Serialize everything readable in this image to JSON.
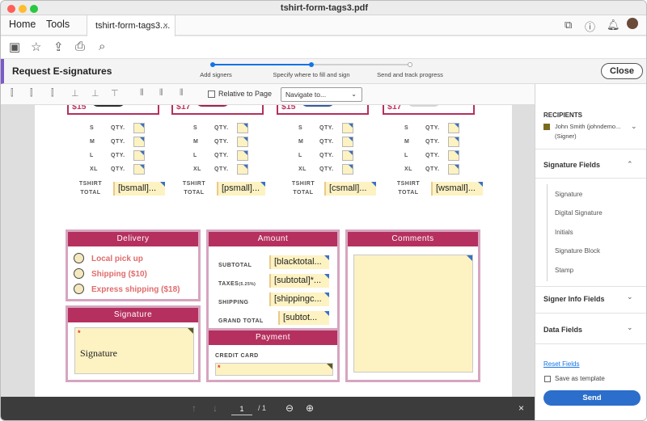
{
  "window": {
    "title": "tshirt-form-tags3.pdf"
  },
  "nav": {
    "home": "Home",
    "tools": "Tools",
    "tab_label": "tshirt-form-tags3....",
    "tab_close": "×"
  },
  "esign": {
    "title": "Request E-signatures",
    "steps": [
      "Add signers",
      "Specify where to fill and sign",
      "Send and track progress"
    ],
    "close": "Close"
  },
  "align_bar": {
    "relative_label": "Relative to Page",
    "navigate_placeholder": "Navigate to...",
    "chevron": "⌄"
  },
  "page_nav": {
    "current": "1",
    "total": "/ 1",
    "close": "×"
  },
  "shirts": [
    {
      "price": "$15",
      "color": "#2b2b2b",
      "total_field": "[bsmall]..."
    },
    {
      "price": "$17",
      "color": "#a0234a",
      "total_field": "[psmall]..."
    },
    {
      "price": "$15",
      "color": "#365a9c",
      "total_field": "[csmall]..."
    },
    {
      "price": "$17",
      "color": "#d5d5d5",
      "total_field": "[wsmall]..."
    }
  ],
  "sizes": [
    "S",
    "M",
    "L",
    "XL"
  ],
  "qty_label": "QTY.",
  "tshirt_total": [
    "TSHIRT",
    "TOTAL"
  ],
  "delivery": {
    "title": "Delivery",
    "options": [
      "Local pick up",
      "Shipping ($10)",
      "Express shipping ($18)"
    ]
  },
  "amount": {
    "title": "Amount",
    "rows": [
      {
        "label": "SUBTOTAL",
        "field": "[blacktotal..."
      },
      {
        "label": "TAXES",
        "sub": "(5.25%)",
        "field": "[subtotal]*..."
      },
      {
        "label": "SHIPPING",
        "field": "[shippingc..."
      },
      {
        "label": "GRAND TOTAL",
        "field": "[subtot..."
      }
    ]
  },
  "comments": {
    "title": "Comments"
  },
  "signature": {
    "title": "Signature",
    "field": "Signature",
    "required": "*"
  },
  "payment": {
    "title": "Payment",
    "card_label": "CREDIT CARD",
    "required": "*"
  },
  "sidebar": {
    "recipients_title": "RECIPIENTS",
    "recipient": "John Smith (johndemo...",
    "recipient_role": "(Signer)",
    "recipient_color": "#7a6a1e",
    "signature_fields": "Signature Fields",
    "sig_items": [
      "Signature",
      "Digital Signature",
      "Initials",
      "Signature Block",
      "Stamp"
    ],
    "signer_info": "Signer Info Fields",
    "data_fields": "Data Fields",
    "reset": "Reset Fields",
    "save_template": "Save as template",
    "send": "Send"
  },
  "colors": {
    "accent": "#1473e6",
    "brand": "#b5305e",
    "field": "#fdf2c2"
  }
}
